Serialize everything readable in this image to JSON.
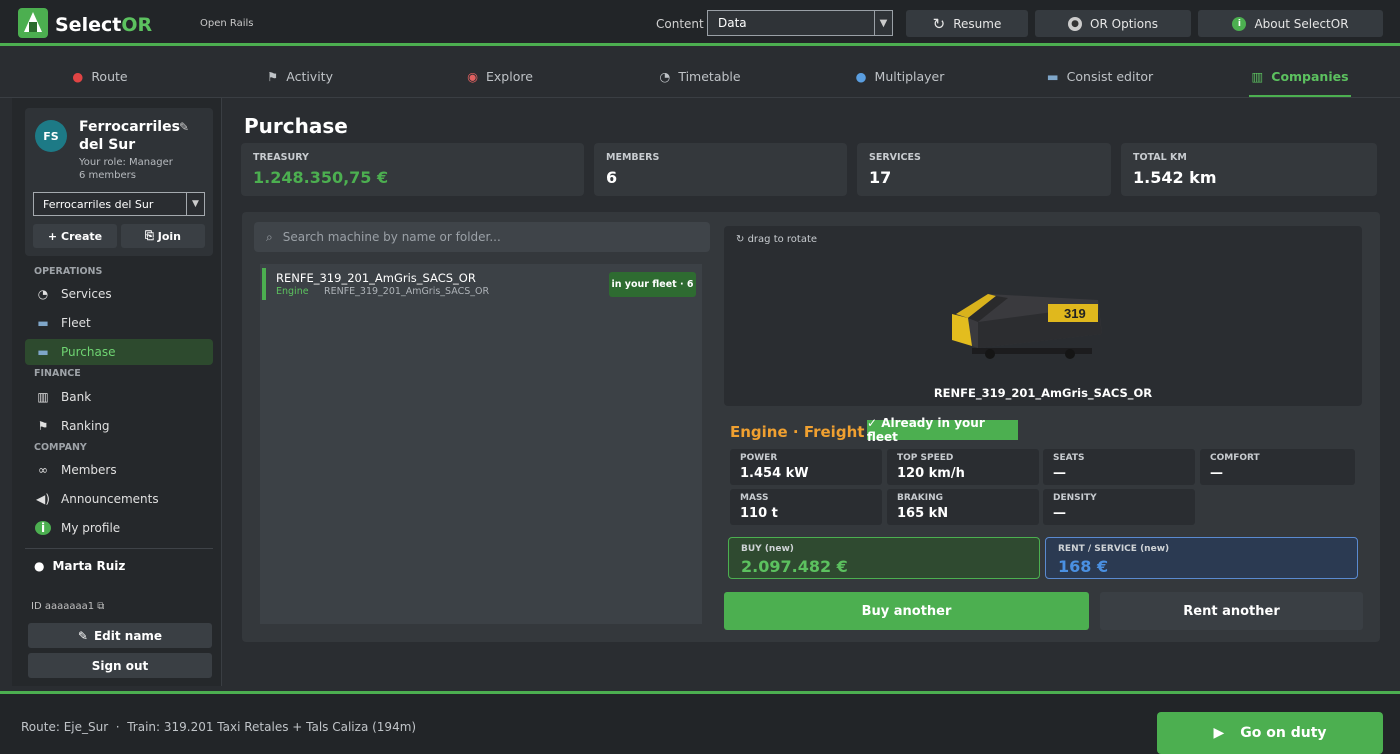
{
  "app": {
    "brand_prefix": "Select",
    "brand_suffix": "OR",
    "sublabel": "Open Rails"
  },
  "header": {
    "content_label": "Content",
    "content_value": "Data",
    "resume": "Resume",
    "options": "OR Options",
    "about": "About SelectOR"
  },
  "tabs": [
    {
      "label": "Route"
    },
    {
      "label": "Activity"
    },
    {
      "label": "Explore"
    },
    {
      "label": "Timetable"
    },
    {
      "label": "Multiplayer"
    },
    {
      "label": "Consist editor"
    },
    {
      "label": "Companies"
    }
  ],
  "company": {
    "initials": "FS",
    "name": "Ferrocarriles del Sur",
    "role": "Your role: Manager",
    "members": "6 members",
    "selected": "Ferrocarriles del Sur",
    "create": "Create",
    "join": "Join"
  },
  "sidebar": {
    "operations": "OPERATIONS",
    "services": "Services",
    "fleet": "Fleet",
    "purchase": "Purchase",
    "finance": "FINANCE",
    "bank": "Bank",
    "ranking": "Ranking",
    "company_section": "COMPANY",
    "members": "Members",
    "announcements": "Announcements",
    "profile": "My profile",
    "user": "Marta Ruiz",
    "id": "ID aaaaaaa1",
    "edit_name": "Edit name",
    "sign_out": "Sign out"
  },
  "page": {
    "title": "Purchase"
  },
  "stats": {
    "treasury_label": "TREASURY",
    "treasury": "1.248.350,75 €",
    "members_label": "MEMBERS",
    "members": "6",
    "services_label": "SERVICES",
    "services": "17",
    "km_label": "TOTAL KM",
    "km": "1.542 km"
  },
  "search": {
    "placeholder": "Search machine by name or folder..."
  },
  "machines": [
    {
      "name": "RENFE_319_201_AmGris_SACS_OR",
      "type": "Engine",
      "folder": "RENFE_319_201_AmGris_SACS_OR",
      "badge": "in your fleet · 6"
    }
  ],
  "detail": {
    "drag_hint": "drag to rotate",
    "caption": "RENFE_319_201_AmGris_SACS_OR",
    "kind": "Engine",
    "sep": "·",
    "cargo": "Freight",
    "already": "✓ Already in your fleet",
    "power_label": "POWER",
    "power": "1.454 kW",
    "speed_label": "TOP SPEED",
    "speed": "120 km/h",
    "seats_label": "SEATS",
    "seats": "—",
    "comfort_label": "COMFORT",
    "comfort": "—",
    "mass_label": "MASS",
    "mass": "110 t",
    "braking_label": "BRAKING",
    "braking": "165 kN",
    "density_label": "DENSITY",
    "density": "—",
    "buy_label": "BUY (new)",
    "buy": "2.097.482 €",
    "rent_label": "RENT / SERVICE (new)",
    "rent": "168 €",
    "buy_btn": "Buy another",
    "rent_btn": "Rent another"
  },
  "footer": {
    "status": "Route: Eje_Sur  ·  Train: 319.201 Taxi Retales + Tals Caliza (194m)",
    "duty": "Go on duty"
  },
  "colors": {
    "accent": "#4caf50",
    "orange": "#f0a030",
    "blue": "#4a90e2"
  }
}
